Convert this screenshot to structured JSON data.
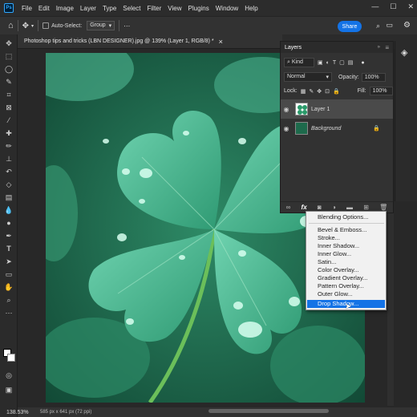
{
  "app": {
    "logo": "Ps"
  },
  "menubar": {
    "items": [
      "File",
      "Edit",
      "Image",
      "Layer",
      "Type",
      "Select",
      "Filter",
      "View",
      "Plugins",
      "Window",
      "Help"
    ],
    "controls": {
      "minimize": "—",
      "maximize": "☐",
      "close": "✕"
    }
  },
  "options": {
    "auto_select_label": "Auto-Select:",
    "group_value": "Group",
    "share_label": "Share"
  },
  "document": {
    "tab_title": "Photoshop tips and tricks (LBN DESIGNER).jpg @ 139% (Layer 1, RGB/8) *",
    "tab_close": "×"
  },
  "status": {
    "zoom": "138.53%",
    "info": "585 px x 641 px (72 ppi)"
  },
  "layers_panel": {
    "title": "Layers",
    "filter_kind": "Kind",
    "blend_mode": "Normal",
    "opacity_label": "Opacity:",
    "opacity_value": "100%",
    "lock_label": "Lock:",
    "fill_label": "Fill:",
    "fill_value": "100%",
    "layers": [
      {
        "name": "Layer 1",
        "selected": true
      },
      {
        "name": "Background",
        "selected": false,
        "locked": true
      }
    ],
    "footer_icons": [
      "link-icon",
      "fx-icon",
      "mask-icon",
      "adjustment-icon",
      "group-folder-icon",
      "new-layer-icon",
      "trash-icon"
    ]
  },
  "fx_menu": {
    "items": [
      "Blending Options...",
      "Bevel & Emboss...",
      "Stroke...",
      "Inner Shadow...",
      "Inner Glow...",
      "Satin...",
      "Color Overlay...",
      "Gradient Overlay...",
      "Pattern Overlay...",
      "Outer Glow...",
      "Drop Shadow..."
    ],
    "selected": "Drop Shadow..."
  },
  "colors": {
    "accent": "#1473e6",
    "panel": "#323232",
    "bg": "#2b2b2b"
  }
}
